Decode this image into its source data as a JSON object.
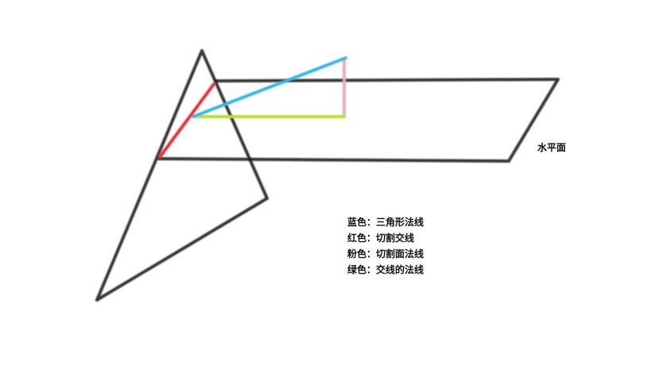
{
  "plane_label": "水平面",
  "legend": {
    "items": [
      {
        "text": "蓝色：三角形法线",
        "color": "#3bb4e6"
      },
      {
        "text": "红色：切割交线",
        "color": "#e0303a"
      },
      {
        "text": "粉色：切割面法线",
        "color": "#f4a6be"
      },
      {
        "text": "绿色：交线的法线",
        "color": "#b5e02a"
      }
    ]
  },
  "colors": {
    "line": "#1f1f1f",
    "background": "#ffffff"
  }
}
